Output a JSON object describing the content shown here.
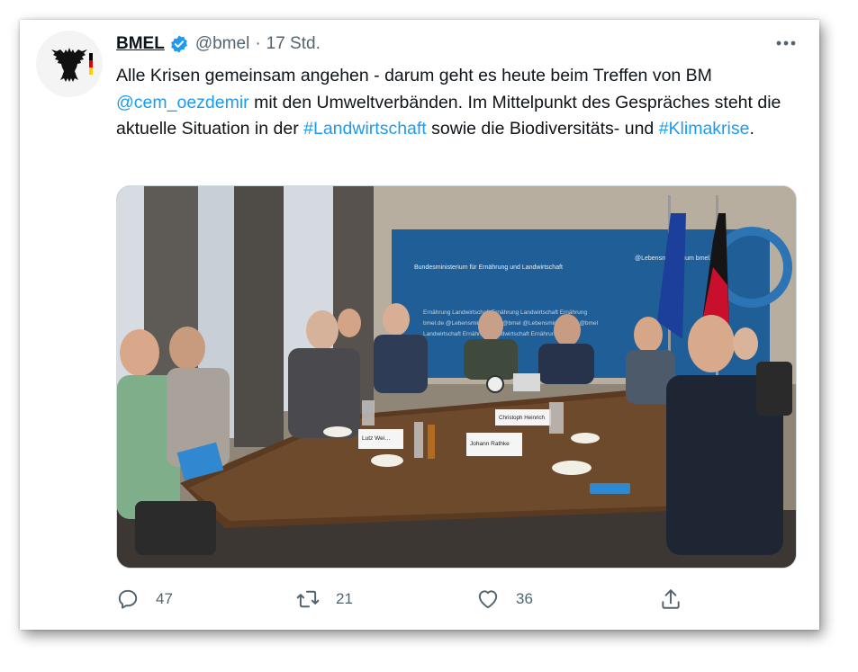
{
  "tweet": {
    "author_name": "BMEL",
    "handle": "@bmel",
    "separator": "·",
    "time": "17 Std.",
    "text_parts": {
      "p1": "Alle Krisen gemeinsam angehen - darum geht es heute beim Treffen von BM ",
      "mention": "@cem_oezdemir",
      "p2": " mit den Umweltverbänden. Im Mittelpunkt des Gespräches steht die aktuelle Situation in der ",
      "hashtag1": "#Landwirtschaft",
      "p3": " sowie die Biodiversitäts- und ",
      "hashtag2": "#Klimakrise",
      "p4": "."
    },
    "image": {
      "backdrop_text": {
        "ministry": "Bundesministerium für Ernährung und Landwirtschaft",
        "social": "@Lebensministerium bmel.de",
        "pattern_line1": "Ernährung   Landwirtschaft   Ernährung   Landwirtschaft   Ernährung",
        "pattern_line2": "bmel.de  @Lebensministerium  @bmel  @Lebensministerium  @bmel",
        "pattern_line3": "Landwirtschaft   Ernährung   Landwirtschaft   Ernährung"
      },
      "name_cards": [
        "Lutz Wei…",
        "Johann Rathke",
        "Christoph Heinrich"
      ]
    },
    "actions": {
      "reply_count": "47",
      "retweet_count": "21",
      "like_count": "36"
    },
    "icons": [
      "eagle-logo-icon",
      "verified-badge-icon",
      "more-icon",
      "reply-icon",
      "retweet-icon",
      "like-icon",
      "share-icon"
    ],
    "colors": {
      "link": "#1d9bf0",
      "verified": "#1d9bf0",
      "muted": "#536471",
      "text": "#0f1419"
    }
  }
}
